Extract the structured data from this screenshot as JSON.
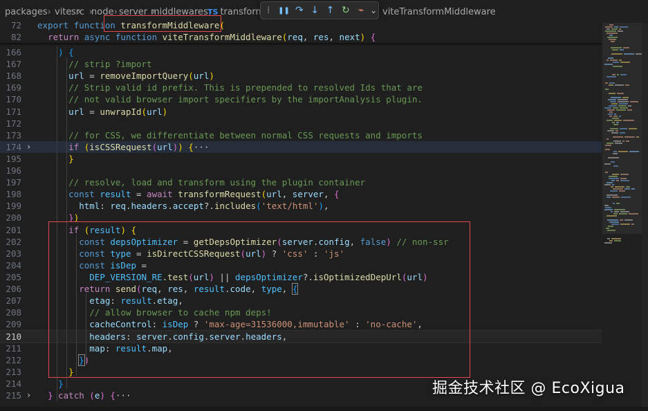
{
  "breadcrumb": {
    "items": [
      "packages",
      "vite",
      "src",
      "node",
      "server",
      "middlewares"
    ],
    "file_badge": "TS",
    "file": "transform.t",
    "symbol": "viteTransformMiddleware"
  },
  "debug_toolbar": {
    "buttons": [
      {
        "name": "drag-handle-icon",
        "glyph": "⁞"
      },
      {
        "name": "pause-icon",
        "glyph": "❚❚"
      },
      {
        "name": "step-over-icon",
        "glyph": "↷"
      },
      {
        "name": "step-into-icon",
        "glyph": "↓"
      },
      {
        "name": "step-out-icon",
        "glyph": "↑"
      },
      {
        "name": "restart-icon",
        "glyph": "↻"
      },
      {
        "name": "disconnect-icon",
        "glyph": "⌁"
      },
      {
        "name": "chevron-down-icon",
        "glyph": "⌄"
      }
    ]
  },
  "editor": {
    "active_line": "210",
    "sticky": [
      {
        "n": "72",
        "toks": [
          [
            "kw",
            "export "
          ],
          [
            "kw",
            "function "
          ],
          [
            "fn",
            "transformMiddleware"
          ],
          [
            "br1",
            "("
          ]
        ]
      },
      {
        "n": "82",
        "toks": [
          [
            "pl",
            "  "
          ],
          [
            "ctl",
            "return "
          ],
          [
            "kw",
            "async "
          ],
          [
            "kw",
            "function "
          ],
          [
            "fn",
            "viteTransformMiddleware"
          ],
          [
            "br1",
            "("
          ],
          [
            "var",
            "req"
          ],
          [
            "pl",
            ", "
          ],
          [
            "var",
            "res"
          ],
          [
            "pl",
            ", "
          ],
          [
            "var",
            "next"
          ],
          [
            "br1",
            ")"
          ],
          [
            "pl",
            " "
          ],
          [
            "br2",
            "{"
          ]
        ]
      }
    ],
    "lines": [
      {
        "n": "166",
        "toks": [
          [
            "pl",
            "    "
          ],
          [
            "br3",
            ")"
          ],
          [
            "pl",
            " "
          ],
          [
            "br3",
            "{"
          ]
        ]
      },
      {
        "n": "167",
        "toks": [
          [
            "pl",
            "      "
          ],
          [
            "cmt",
            "// strip ?import"
          ]
        ]
      },
      {
        "n": "168",
        "toks": [
          [
            "pl",
            "      "
          ],
          [
            "var",
            "url"
          ],
          [
            "pl",
            " = "
          ],
          [
            "fn",
            "removeImportQuery"
          ],
          [
            "br1",
            "("
          ],
          [
            "var",
            "url"
          ],
          [
            "br1",
            ")"
          ]
        ]
      },
      {
        "n": "169",
        "toks": [
          [
            "pl",
            "      "
          ],
          [
            "cmt",
            "// Strip valid id prefix. This is prepended to resolved Ids that are"
          ]
        ]
      },
      {
        "n": "170",
        "toks": [
          [
            "pl",
            "      "
          ],
          [
            "cmt",
            "// not valid browser import specifiers by the importAnalysis plugin."
          ]
        ]
      },
      {
        "n": "171",
        "toks": [
          [
            "pl",
            "      "
          ],
          [
            "var",
            "url"
          ],
          [
            "pl",
            " = "
          ],
          [
            "fn",
            "unwrapId"
          ],
          [
            "br1",
            "("
          ],
          [
            "var",
            "url"
          ],
          [
            "br1",
            ")"
          ]
        ]
      },
      {
        "n": "172",
        "toks": []
      },
      {
        "n": "173",
        "toks": [
          [
            "pl",
            "      "
          ],
          [
            "cmt",
            "// for CSS, we differentiate between normal CSS requests and imports"
          ]
        ]
      },
      {
        "n": "174",
        "fold": "›",
        "hl": true,
        "toks": [
          [
            "pl",
            "      "
          ],
          [
            "ctl",
            "if"
          ],
          [
            "pl",
            " "
          ],
          [
            "br1",
            "("
          ],
          [
            "fn",
            "isCSSRequest"
          ],
          [
            "br2",
            "("
          ],
          [
            "var",
            "url"
          ],
          [
            "br2",
            ")"
          ],
          [
            "br1",
            ")"
          ],
          [
            "pl",
            " "
          ],
          [
            "br1",
            "{"
          ],
          [
            "pl",
            "···"
          ]
        ]
      },
      {
        "n": "195",
        "toks": [
          [
            "pl",
            "      "
          ],
          [
            "br1",
            "}"
          ]
        ]
      },
      {
        "n": "196",
        "toks": []
      },
      {
        "n": "197",
        "toks": [
          [
            "pl",
            "      "
          ],
          [
            "cmt",
            "// resolve, load and transform using the plugin container"
          ]
        ]
      },
      {
        "n": "198",
        "toks": [
          [
            "pl",
            "      "
          ],
          [
            "kw",
            "const "
          ],
          [
            "cst",
            "result"
          ],
          [
            "pl",
            " = "
          ],
          [
            "ctl",
            "await "
          ],
          [
            "fn",
            "transformRequest"
          ],
          [
            "br1",
            "("
          ],
          [
            "var",
            "url"
          ],
          [
            "pl",
            ", "
          ],
          [
            "var",
            "server"
          ],
          [
            "pl",
            ", "
          ],
          [
            "br2",
            "{"
          ]
        ]
      },
      {
        "n": "199",
        "toks": [
          [
            "pl",
            "        "
          ],
          [
            "var",
            "html"
          ],
          [
            "pl",
            ": "
          ],
          [
            "var",
            "req"
          ],
          [
            "pl",
            "."
          ],
          [
            "var",
            "headers"
          ],
          [
            "pl",
            "."
          ],
          [
            "var",
            "accept"
          ],
          [
            "pl",
            "?."
          ],
          [
            "fn",
            "includes"
          ],
          [
            "br3",
            "("
          ],
          [
            "str",
            "'text/html'"
          ],
          [
            "br3",
            ")"
          ],
          [
            "pl",
            ","
          ]
        ]
      },
      {
        "n": "200",
        "toks": [
          [
            "pl",
            "      "
          ],
          [
            "br2",
            "}"
          ],
          [
            "br1",
            ")"
          ]
        ]
      },
      {
        "n": "201",
        "toks": [
          [
            "pl",
            "      "
          ],
          [
            "ctl",
            "if"
          ],
          [
            "pl",
            " "
          ],
          [
            "br1",
            "("
          ],
          [
            "cst",
            "result"
          ],
          [
            "br1",
            ")"
          ],
          [
            "pl",
            " "
          ],
          [
            "br1",
            "{"
          ]
        ]
      },
      {
        "n": "202",
        "toks": [
          [
            "pl",
            "        "
          ],
          [
            "kw",
            "const "
          ],
          [
            "cst",
            "depsOptimizer"
          ],
          [
            "pl",
            " = "
          ],
          [
            "fn",
            "getDepsOptimizer"
          ],
          [
            "br2",
            "("
          ],
          [
            "var",
            "server"
          ],
          [
            "pl",
            "."
          ],
          [
            "var",
            "config"
          ],
          [
            "pl",
            ", "
          ],
          [
            "kw",
            "false"
          ],
          [
            "br2",
            ")"
          ],
          [
            "pl",
            " "
          ],
          [
            "cmt",
            "// non-ssr"
          ]
        ]
      },
      {
        "n": "203",
        "toks": [
          [
            "pl",
            "        "
          ],
          [
            "kw",
            "const "
          ],
          [
            "cst",
            "type"
          ],
          [
            "pl",
            " = "
          ],
          [
            "fn",
            "isDirectCSSRequest"
          ],
          [
            "br2",
            "("
          ],
          [
            "var",
            "url"
          ],
          [
            "br2",
            ")"
          ],
          [
            "pl",
            " ? "
          ],
          [
            "str",
            "'css'"
          ],
          [
            "pl",
            " : "
          ],
          [
            "str",
            "'js'"
          ]
        ]
      },
      {
        "n": "204",
        "toks": [
          [
            "pl",
            "        "
          ],
          [
            "kw",
            "const "
          ],
          [
            "cst",
            "isDep"
          ],
          [
            "pl",
            " ="
          ]
        ]
      },
      {
        "n": "205",
        "toks": [
          [
            "pl",
            "          "
          ],
          [
            "cst",
            "DEP_VERSION_RE"
          ],
          [
            "pl",
            "."
          ],
          [
            "fn",
            "test"
          ],
          [
            "br2",
            "("
          ],
          [
            "var",
            "url"
          ],
          [
            "br2",
            ")"
          ],
          [
            "pl",
            " || "
          ],
          [
            "cst",
            "depsOptimizer"
          ],
          [
            "pl",
            "?."
          ],
          [
            "fn",
            "isOptimizedDepUrl"
          ],
          [
            "br2",
            "("
          ],
          [
            "var",
            "url"
          ],
          [
            "br2",
            ")"
          ]
        ]
      },
      {
        "n": "206",
        "toks": [
          [
            "pl",
            "        "
          ],
          [
            "ctl",
            "return "
          ],
          [
            "fn",
            "send"
          ],
          [
            "br2",
            "("
          ],
          [
            "var",
            "req"
          ],
          [
            "pl",
            ", "
          ],
          [
            "var",
            "res"
          ],
          [
            "pl",
            ", "
          ],
          [
            "cst",
            "result"
          ],
          [
            "pl",
            "."
          ],
          [
            "var",
            "code"
          ],
          [
            "pl",
            ", "
          ],
          [
            "cst",
            "type"
          ],
          [
            "pl",
            ", "
          ],
          [
            "br3m",
            "{"
          ]
        ]
      },
      {
        "n": "207",
        "toks": [
          [
            "pl",
            "          "
          ],
          [
            "var",
            "etag"
          ],
          [
            "pl",
            ": "
          ],
          [
            "cst",
            "result"
          ],
          [
            "pl",
            "."
          ],
          [
            "var",
            "etag"
          ],
          [
            "pl",
            ","
          ]
        ]
      },
      {
        "n": "208",
        "toks": [
          [
            "pl",
            "          "
          ],
          [
            "cmt",
            "// allow browser to cache npm deps!"
          ]
        ]
      },
      {
        "n": "209",
        "toks": [
          [
            "pl",
            "          "
          ],
          [
            "var",
            "cacheControl"
          ],
          [
            "pl",
            ": "
          ],
          [
            "cst",
            "isDep"
          ],
          [
            "pl",
            " ? "
          ],
          [
            "str",
            "'max-age=31536000,immutable'"
          ],
          [
            "pl",
            " : "
          ],
          [
            "str",
            "'no-cache'"
          ],
          [
            "pl",
            ","
          ]
        ]
      },
      {
        "n": "210",
        "cur": true,
        "toks": [
          [
            "pl",
            "          "
          ],
          [
            "var",
            "headers"
          ],
          [
            "pl",
            ": "
          ],
          [
            "var",
            "server"
          ],
          [
            "pl",
            "."
          ],
          [
            "var",
            "config"
          ],
          [
            "pl",
            "."
          ],
          [
            "var",
            "server"
          ],
          [
            "pl",
            "."
          ],
          [
            "var",
            "headers"
          ],
          [
            "pl",
            ","
          ]
        ]
      },
      {
        "n": "211",
        "toks": [
          [
            "pl",
            "          "
          ],
          [
            "var",
            "map"
          ],
          [
            "pl",
            ": "
          ],
          [
            "cst",
            "result"
          ],
          [
            "pl",
            "."
          ],
          [
            "var",
            "map"
          ],
          [
            "pl",
            ","
          ]
        ]
      },
      {
        "n": "212",
        "toks": [
          [
            "pl",
            "        "
          ],
          [
            "br3m",
            "}"
          ],
          [
            "br2",
            ")"
          ]
        ]
      },
      {
        "n": "213",
        "toks": [
          [
            "pl",
            "      "
          ],
          [
            "br1",
            "}"
          ]
        ]
      },
      {
        "n": "214",
        "toks": [
          [
            "pl",
            "    "
          ],
          [
            "br3",
            "}"
          ]
        ]
      },
      {
        "n": "215",
        "fold": "›",
        "toks": [
          [
            "pl",
            "  "
          ],
          [
            "br2",
            "}"
          ],
          [
            "pl",
            " "
          ],
          [
            "ctl",
            "catch"
          ],
          [
            "pl",
            " "
          ],
          [
            "br2",
            "("
          ],
          [
            "var",
            "e"
          ],
          [
            "br2",
            ")"
          ],
          [
            "pl",
            " "
          ],
          [
            "br2",
            "{"
          ],
          [
            "pl",
            "···"
          ]
        ]
      }
    ]
  },
  "watermark": "掘金技术社区 @ EcoXigua",
  "colors": {
    "background": "#1f1f1f",
    "keyword": "#569cd6",
    "control": "#c586c0",
    "function": "#dcdcaa",
    "variable": "#9cdcfe",
    "constant": "#4fc1ff",
    "string": "#ce9178",
    "comment": "#6a9955",
    "annotation_box": "#e5484d"
  }
}
